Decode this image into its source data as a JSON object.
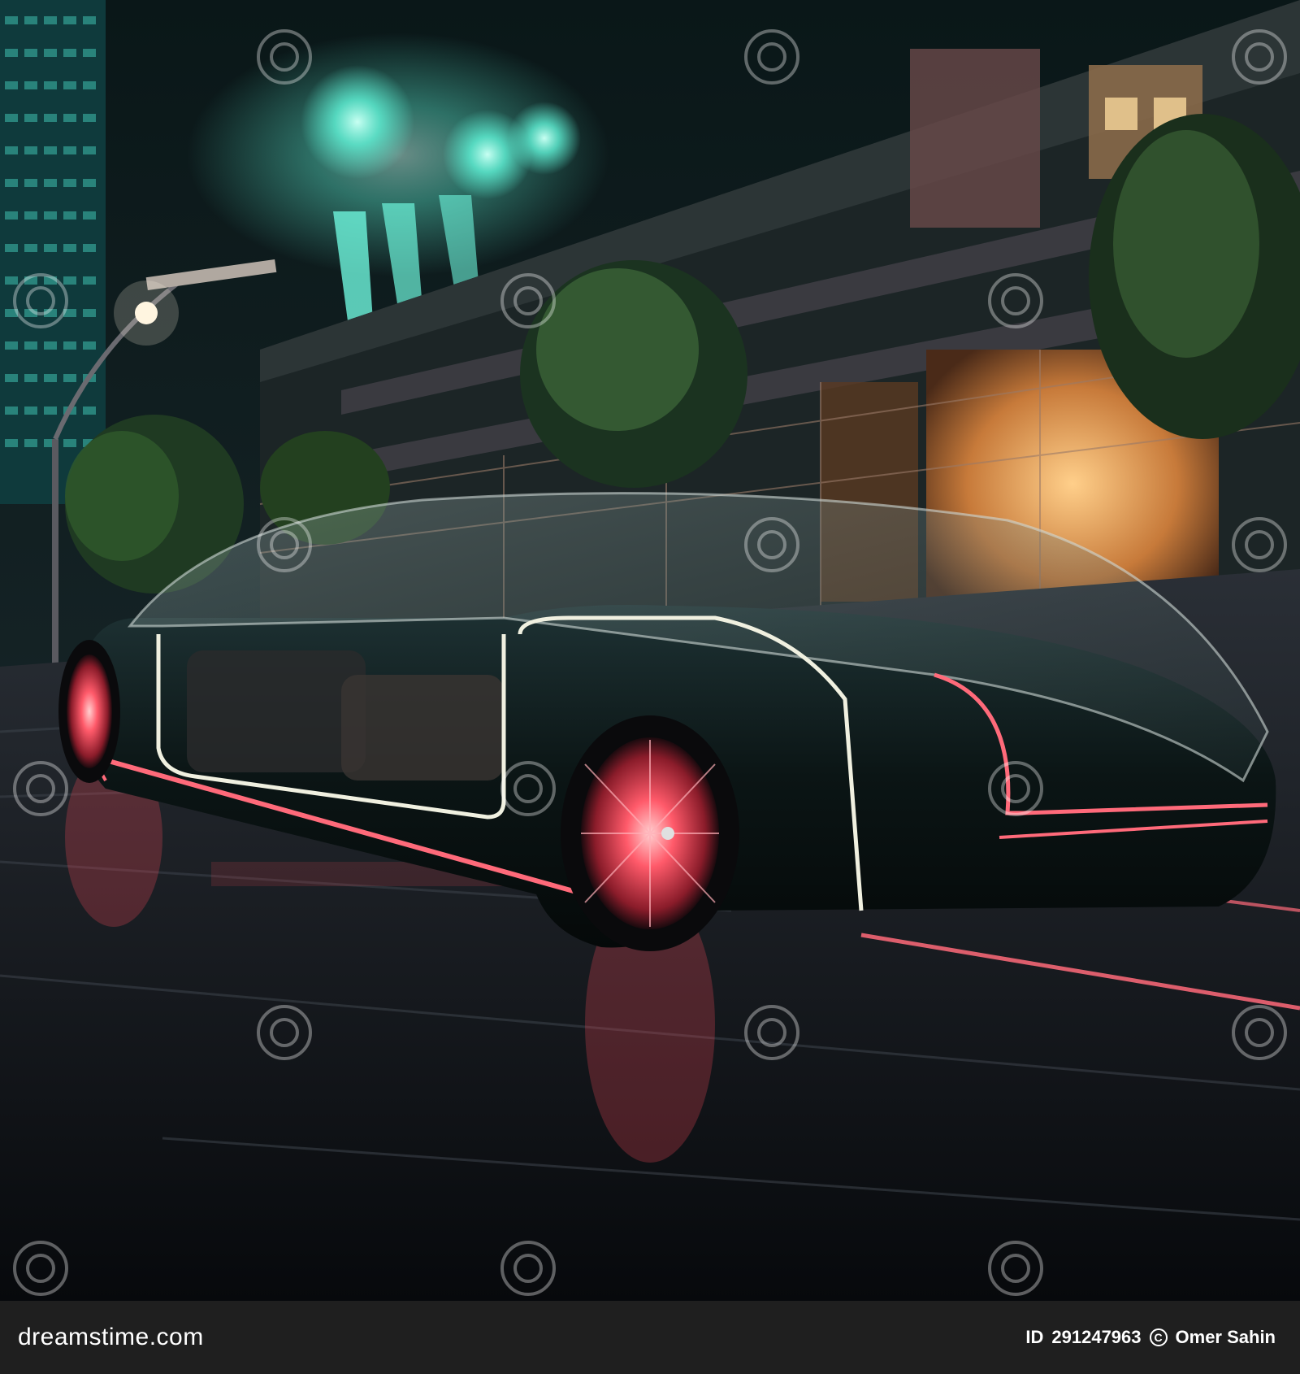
{
  "image": {
    "alt": "Futuristic glass-roofed black car with neon red accent lights on a city street at night",
    "watermark_brand": "dreamstime"
  },
  "footer": {
    "site": "dreamstime.com",
    "id_label": "ID",
    "id_value": "291247963",
    "copyright_icon": "copyright-icon",
    "author": "Omer Sahin"
  },
  "colors": {
    "neon_red": "#ff4a5a",
    "teal_glow": "#5ff2d6",
    "night_sky": "#0b1a1c",
    "footer_bg": "#1f1f1f"
  }
}
